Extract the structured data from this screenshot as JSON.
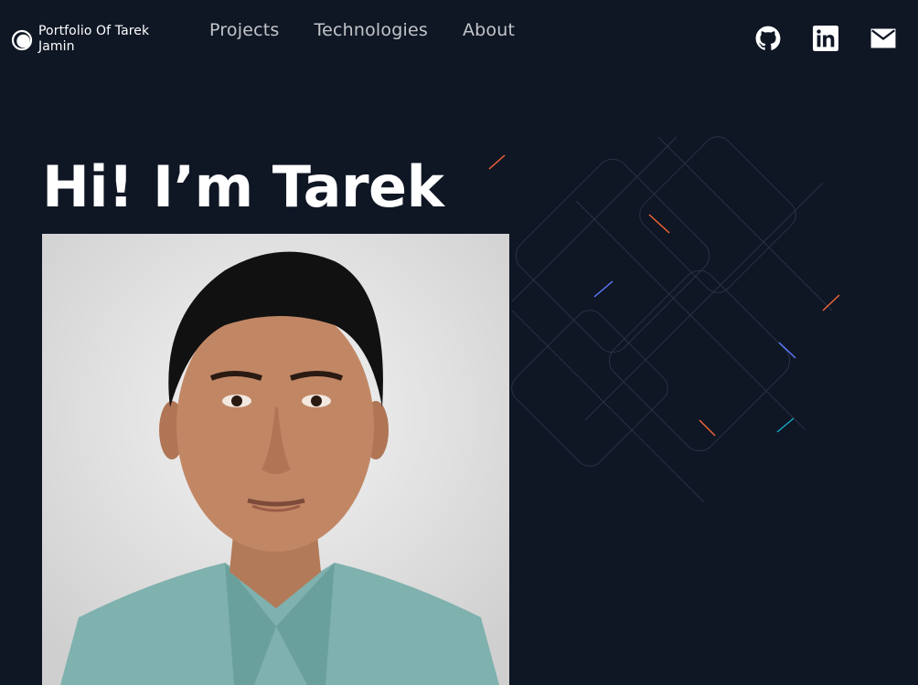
{
  "brand": {
    "title": "Portfolio Of Tarek Jamin",
    "logo_icon": "circle-logo-icon"
  },
  "nav": {
    "items": [
      {
        "label": "Projects"
      },
      {
        "label": "Technologies"
      },
      {
        "label": "About"
      }
    ]
  },
  "social": {
    "github_icon": "github-icon",
    "linkedin_icon": "linkedin-icon",
    "mail_icon": "mail-icon"
  },
  "hero": {
    "title": "Hi! I’m Tarek"
  },
  "colors": {
    "background": "#0f1624",
    "text": "#ffffff",
    "nav_text": "#c5c8cf",
    "accent_orange": "#f46737",
    "accent_blue": "#5d7bff",
    "accent_teal": "#13adc7"
  }
}
